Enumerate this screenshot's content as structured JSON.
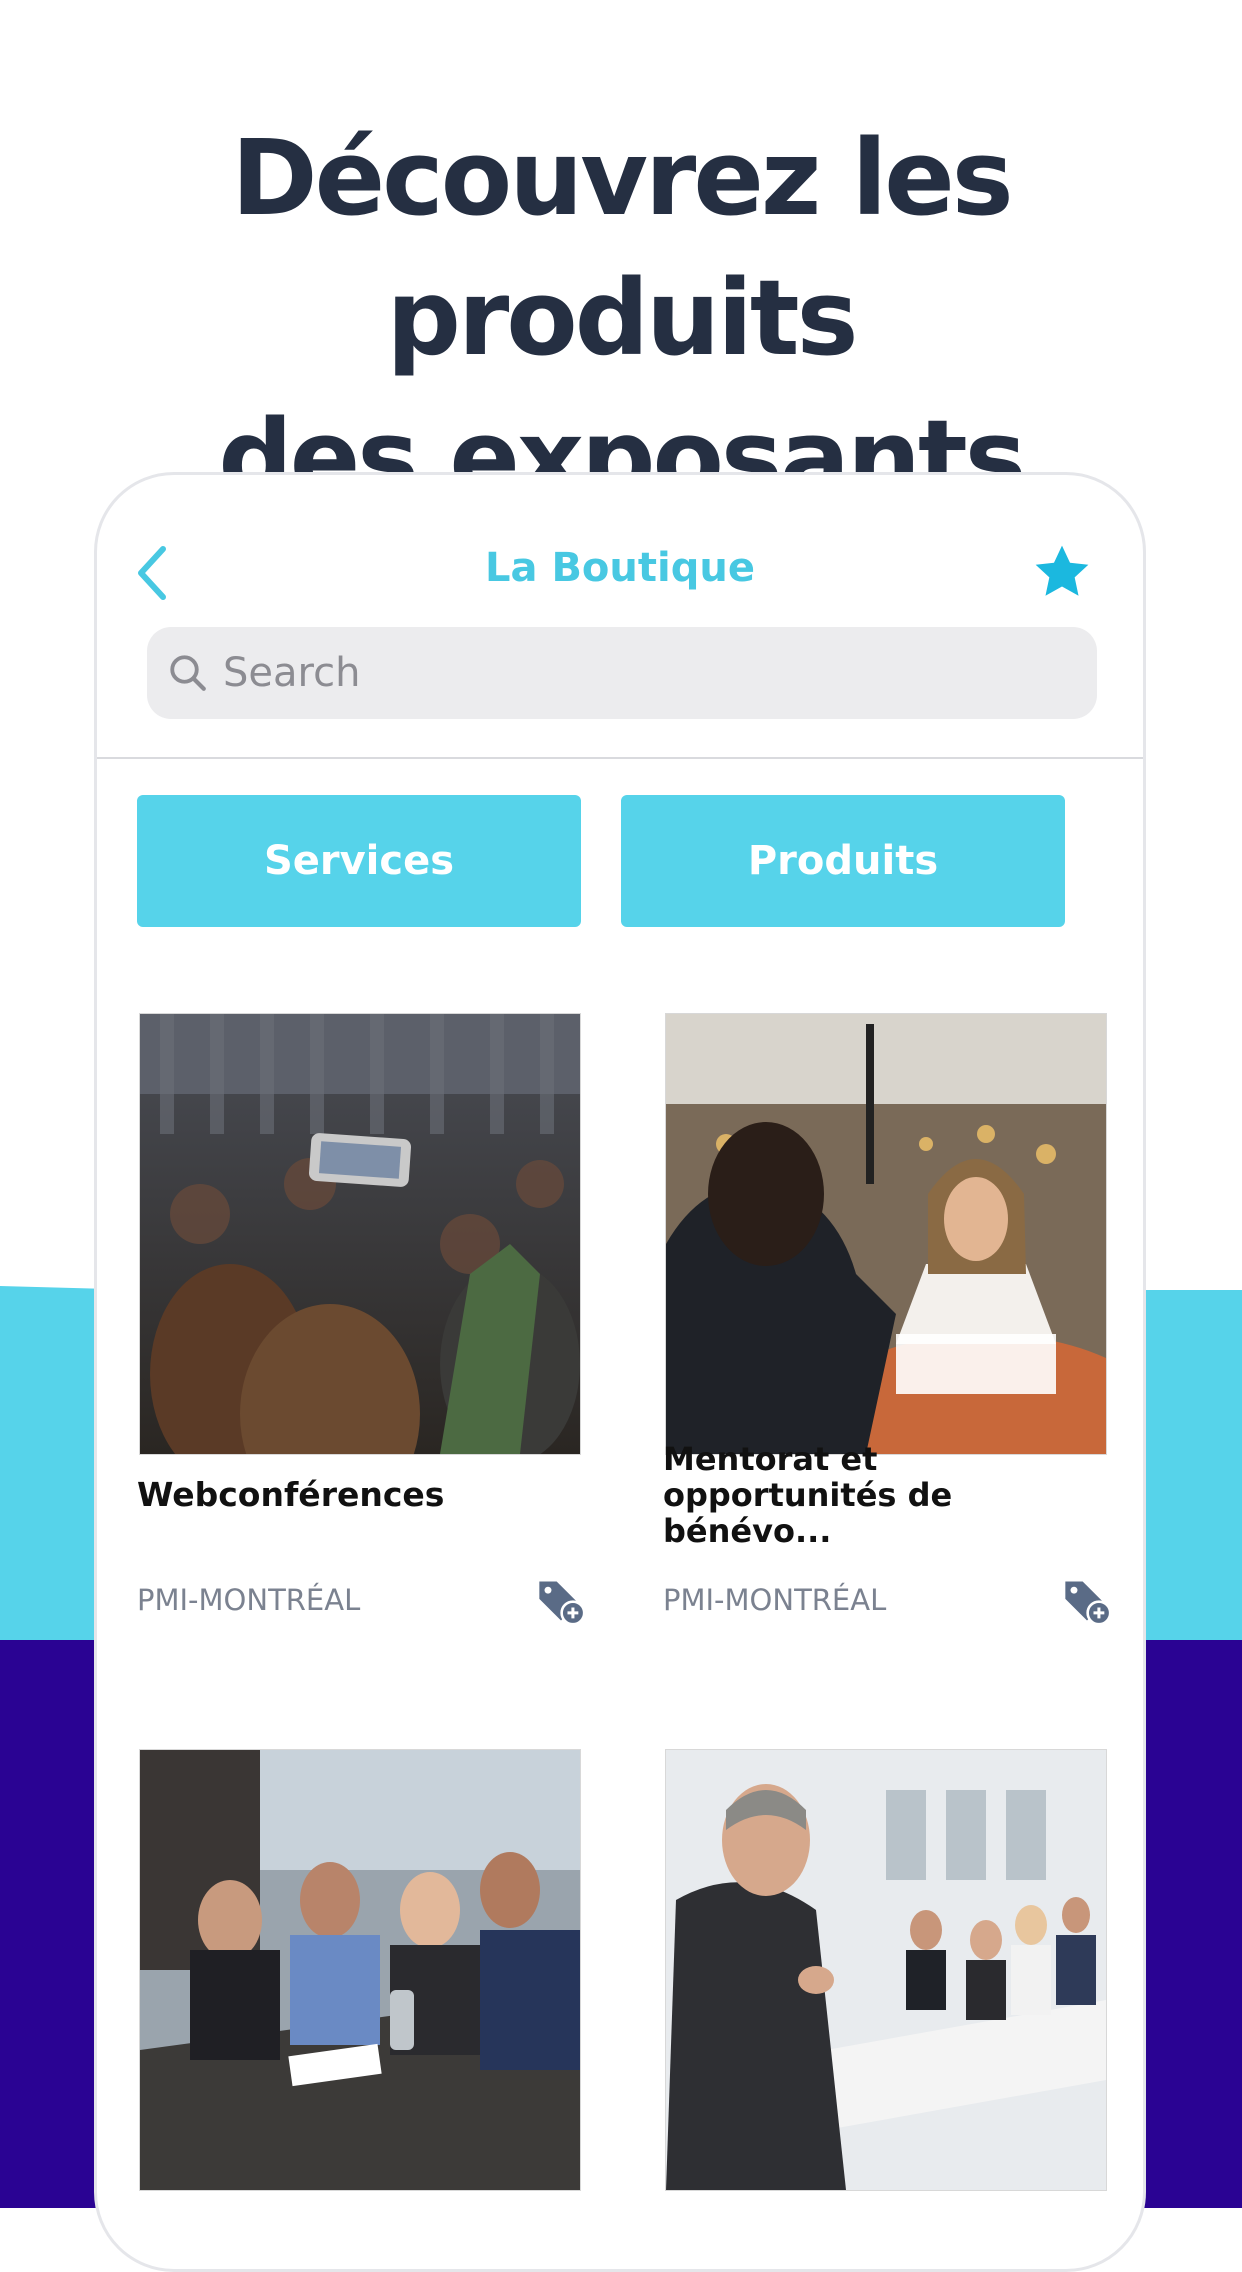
{
  "headline": {
    "line1": "Découvrez les produits",
    "line2": "des exposants"
  },
  "nav": {
    "back_icon": "chevron-left-icon",
    "title": "La Boutique",
    "favorite_icon": "star-icon"
  },
  "search": {
    "placeholder": "Search",
    "icon": "search-icon"
  },
  "tabs": [
    {
      "label": "Services"
    },
    {
      "label": "Produits"
    }
  ],
  "cards": [
    {
      "title": "Webconférences",
      "org": "PMI-MONTRÉAL",
      "image": "audience-phone-photo"
    },
    {
      "title_line1": "Mentorat et",
      "title_line2": "opportunités de bénévo...",
      "org": "PMI-MONTRÉAL",
      "image": "mentoring-meeting-photo"
    },
    {
      "title": "",
      "org": "",
      "image": "team-table-photo"
    },
    {
      "title": "",
      "org": "",
      "image": "presenter-classroom-photo"
    }
  ],
  "colors": {
    "accent": "#56d3ea",
    "accent_text": "#48c8e2",
    "purple": "#2a0393",
    "headline": "#252f42",
    "tag_icon": "#5a6b86"
  }
}
